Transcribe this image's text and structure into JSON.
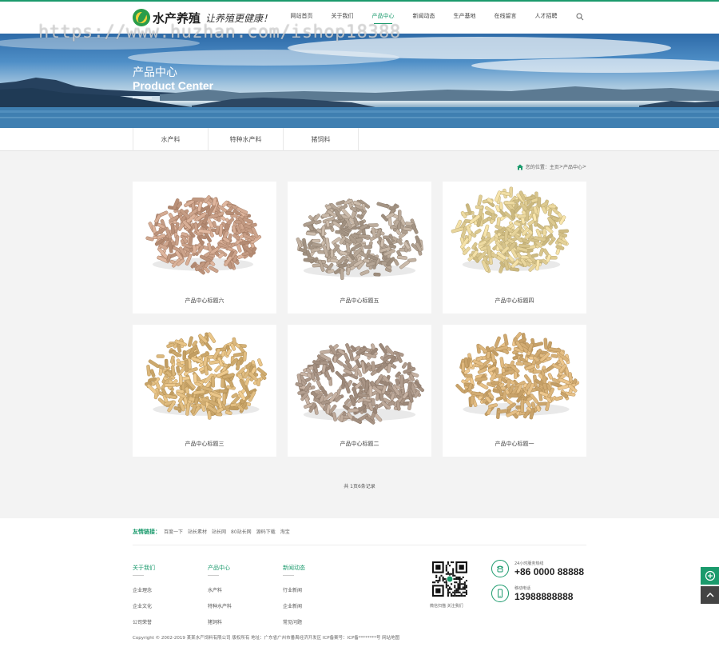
{
  "header": {
    "logo_text": "水产养殖",
    "slogan": "让养殖更健康！",
    "nav": [
      "网站首页",
      "关于我们",
      "产品中心",
      "新闻动态",
      "生产基地",
      "在线留言",
      "人才招聘"
    ],
    "active_index": 2
  },
  "watermark": "https://www.huzhan.com/ishop18388",
  "banner": {
    "title": "产品中心",
    "subtitle": "Product Center"
  },
  "tabs": [
    "水产料",
    "特种水产料",
    "猪饲料"
  ],
  "breadcrumb": {
    "prefix": "您的位置：",
    "home": "主页",
    "sep": " > ",
    "current": "产品中心",
    "tail": " >"
  },
  "products": [
    {
      "label": "产品中心标题六",
      "color": "#c9a088"
    },
    {
      "label": "产品中心标题五",
      "color": "#b5a595"
    },
    {
      "label": "产品中心标题四",
      "color": "#e2cf96"
    },
    {
      "label": "产品中心标题三",
      "color": "#d9b579"
    },
    {
      "label": "产品中心标题二",
      "color": "#b19d8e"
    },
    {
      "label": "产品中心标题一",
      "color": "#d9b37a"
    }
  ],
  "pager": {
    "text": "共 1页6条记录"
  },
  "footer": {
    "links_title": "友情链接：",
    "links": [
      "百度一下",
      "站长素材",
      "站长网",
      "80站长网",
      "源码下载",
      "淘宝"
    ],
    "columns": [
      {
        "title": "关于我们",
        "items": [
          "企业理念",
          "企业文化",
          "公司荣誉"
        ]
      },
      {
        "title": "产品中心",
        "items": [
          "水产料",
          "特种水产料",
          "猪饲料"
        ]
      },
      {
        "title": "新闻动态",
        "items": [
          "行业新闻",
          "企业新闻",
          "常见问题"
        ]
      }
    ],
    "qr_caption": "微信扫描 关注我们",
    "contacts": [
      {
        "label": "24小时服务热线",
        "value": "+86 0000 88888"
      },
      {
        "label": "移动电话",
        "value": "13988888888"
      }
    ],
    "copyright": "Copyright © 2002-2019 某某水产饲料有限公司 版权所有    地址：广东省广州市番禺经济开发区    ICP备案号：ICP备********号    网站地图"
  },
  "colors": {
    "accent": "#1a9a6c"
  }
}
